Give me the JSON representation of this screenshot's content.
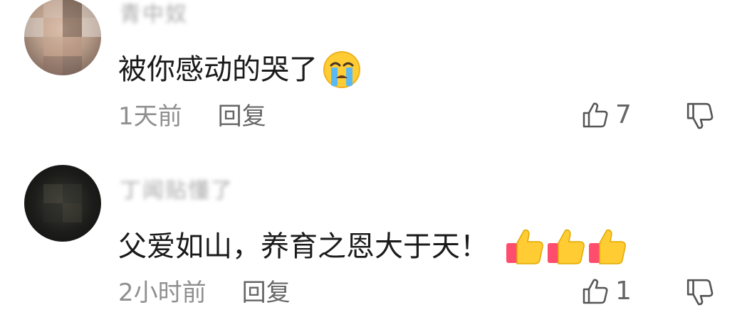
{
  "comments": [
    {
      "username": "青中奴",
      "text": "被你感动的哭了",
      "emoji": "crying-face",
      "time": "1天前",
      "reply_label": "回复",
      "likes": "7"
    },
    {
      "username": "丁闻贴懂了",
      "text": "父爱如山，养育之恩大于天！",
      "emoji": "thumbs-up x3",
      "time": "2小时前",
      "reply_label": "回复",
      "likes": "1"
    }
  ]
}
